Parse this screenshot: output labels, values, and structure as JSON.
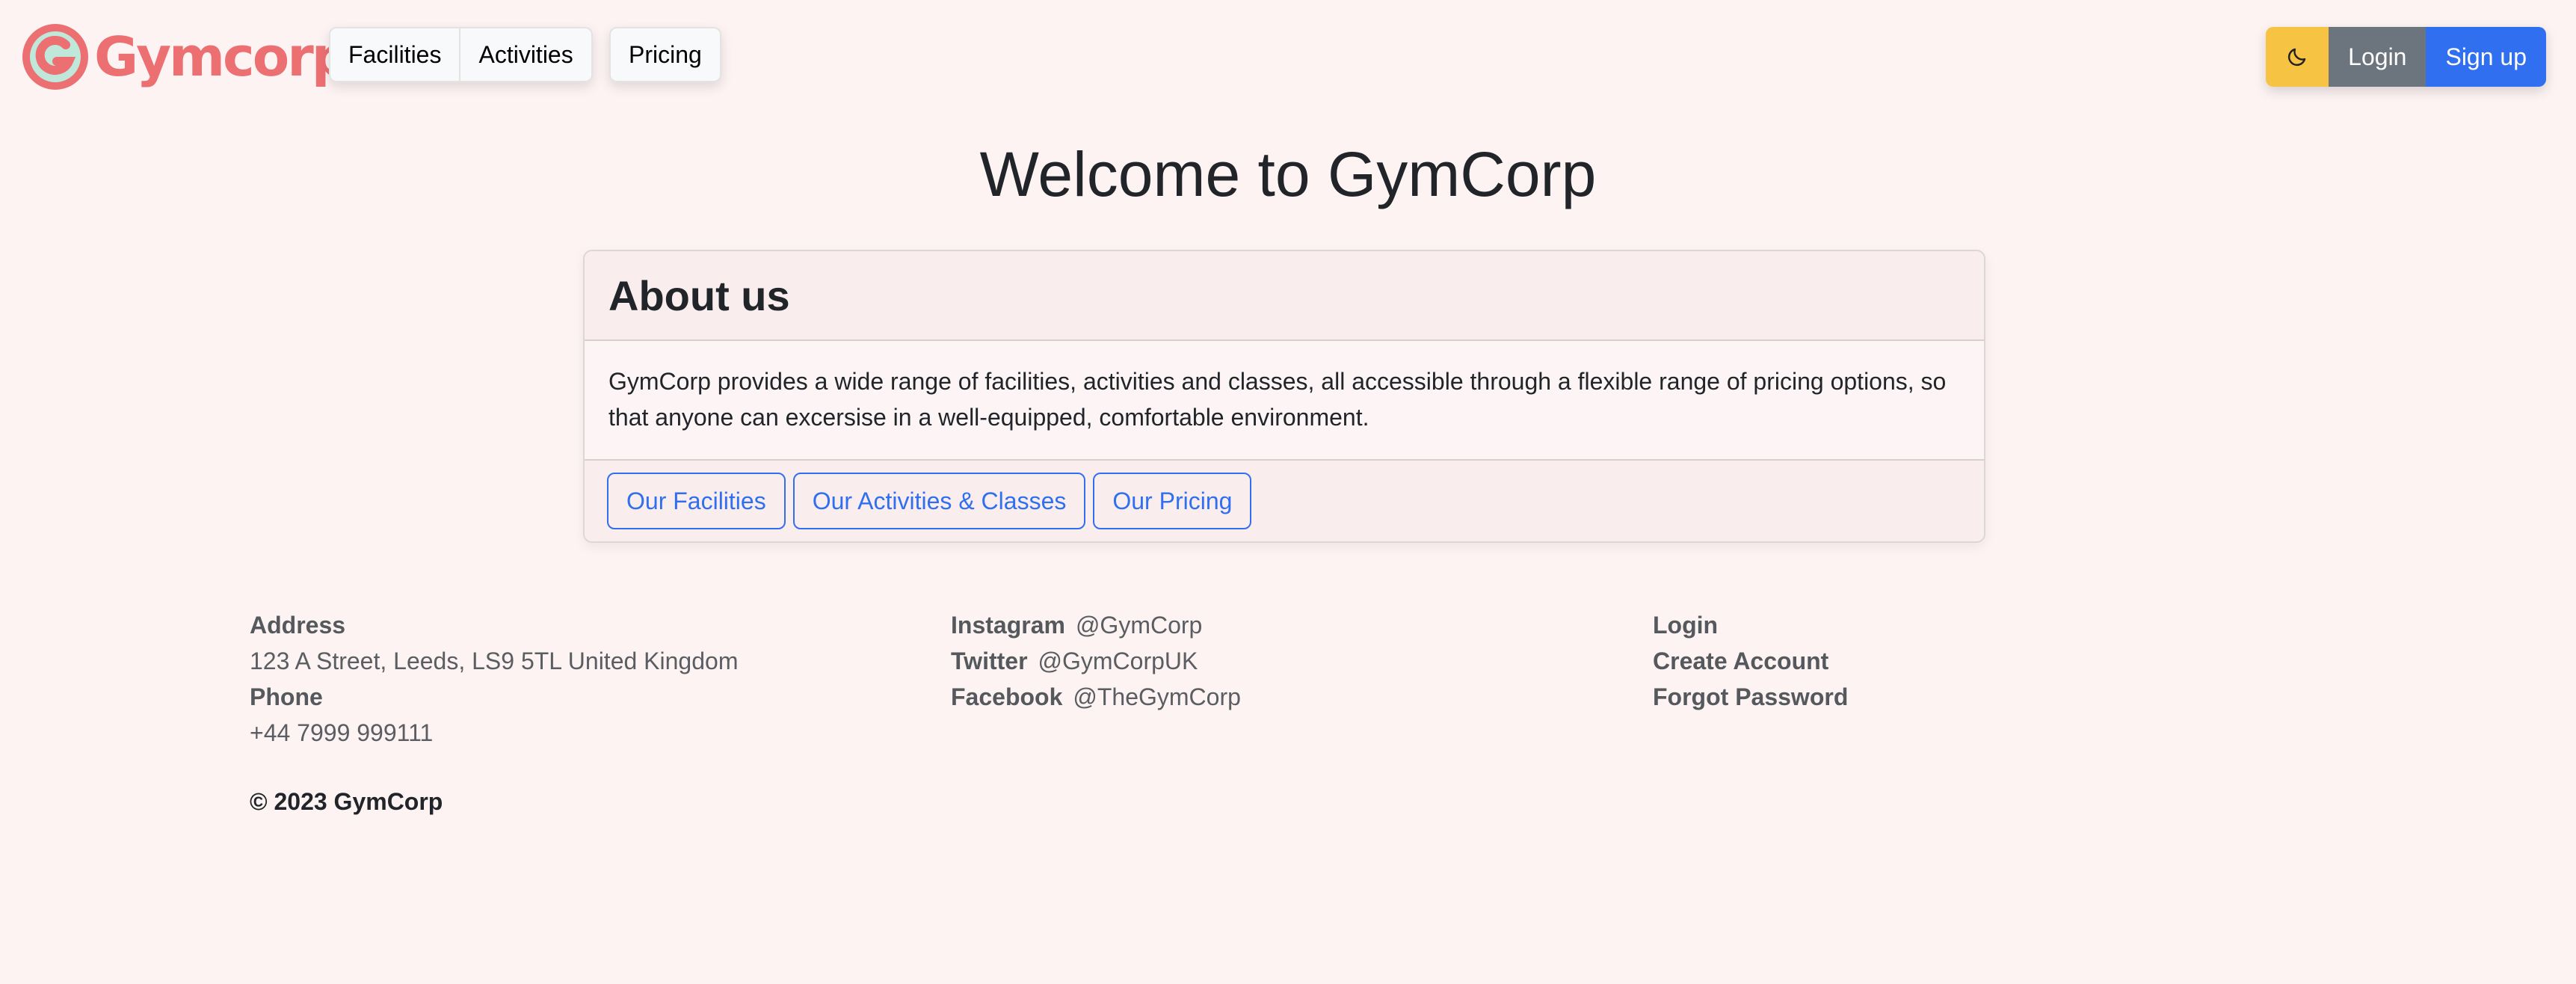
{
  "brand": {
    "name": "Gymcorp"
  },
  "nav": {
    "facilities": "Facilities",
    "activities": "Activities",
    "pricing": "Pricing"
  },
  "auth": {
    "theme_icon": "moon-icon",
    "login": "Login",
    "signup": "Sign up"
  },
  "main": {
    "title": "Welcome to GymCorp",
    "card": {
      "header": "About us",
      "body": "GymCorp provides a wide range of facilities, activities and classes, all accessible through a flexible range of pricing options, so that anyone can excersise in a well-equipped, comfortable environment.",
      "buttons": [
        "Our Facilities",
        "Our Activities & Classes",
        "Our Pricing"
      ]
    }
  },
  "footer": {
    "address_label": "Address",
    "address": "123 A Street, Leeds, LS9 5TL United Kingdom",
    "phone_label": "Phone",
    "phone": "+44 7999 999111",
    "social": [
      {
        "label": "Instagram",
        "handle": "@GymCorp"
      },
      {
        "label": "Twitter",
        "handle": "@GymCorpUK"
      },
      {
        "label": "Facebook",
        "handle": "@TheGymCorp"
      }
    ],
    "links": [
      "Login",
      "Create Account",
      "Forgot Password"
    ],
    "copyright": "© 2023 GymCorp"
  },
  "colors": {
    "background": "#fdf3f3",
    "brand": "#ec6f72",
    "primary": "#2f6ff0",
    "secondary": "#6c757d",
    "warning": "#f6c343"
  }
}
